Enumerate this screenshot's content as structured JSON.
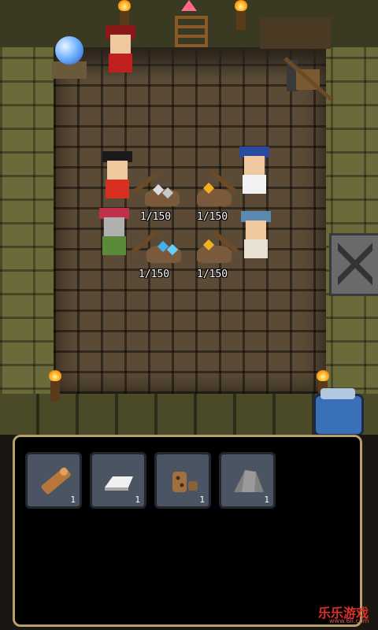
{
  "mine": {
    "counters": [
      {
        "text": "1/150"
      },
      {
        "text": "1/150"
      },
      {
        "text": "1/150"
      },
      {
        "text": "1/150"
      }
    ]
  },
  "inventory": {
    "items": [
      {
        "icon": "wood-log-icon",
        "qty": "1"
      },
      {
        "icon": "silver-ingot-icon",
        "qty": "1"
      },
      {
        "icon": "copper-ore-icon",
        "qty": "1"
      },
      {
        "icon": "stone-icon",
        "qty": "1"
      }
    ]
  },
  "watermark": {
    "text": "乐乐游戏",
    "url": "www.6ll.com"
  },
  "colors": {
    "panel_border": "#b8a06a",
    "slot_bg": "#4a5462",
    "floor": "#5a4a36",
    "wall": "#6b6a3a"
  }
}
